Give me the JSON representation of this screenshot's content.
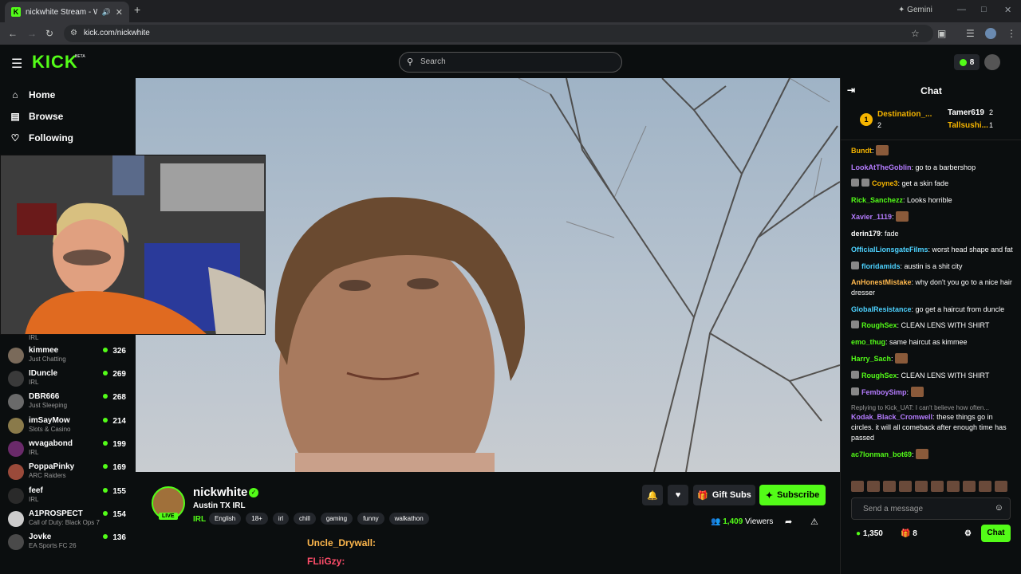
{
  "browser": {
    "tab_title": "nickwhite Stream - Watch L...",
    "favicon_text": "K",
    "new_tab": "+",
    "gemini_label": "Gemini",
    "url": "kick.com/nickwhite"
  },
  "header": {
    "logo": "KICK",
    "beta": "BETA",
    "search_placeholder": "Search",
    "points": "8"
  },
  "sidebar": {
    "nav": [
      {
        "label": "Home",
        "icon": "home-icon"
      },
      {
        "label": "Browse",
        "icon": "browse-icon"
      },
      {
        "label": "Following",
        "icon": "heart-icon"
      }
    ],
    "partial_category": "IRL",
    "channels": [
      {
        "name": "kimmee",
        "category": "Just Chatting",
        "viewers": "326"
      },
      {
        "name": "IDuncle",
        "category": "IRL",
        "viewers": "269"
      },
      {
        "name": "DBR666",
        "category": "Just Sleeping",
        "viewers": "268"
      },
      {
        "name": "imSayMow",
        "category": "Slots & Casino",
        "viewers": "214"
      },
      {
        "name": "wvagabond",
        "category": "IRL",
        "viewers": "199"
      },
      {
        "name": "PoppaPinky",
        "category": "ARC Raiders",
        "viewers": "169"
      },
      {
        "name": "feef",
        "category": "IRL",
        "viewers": "155"
      },
      {
        "name": "A1PROSPECT",
        "category": "Call of Duty: Black Ops 7",
        "viewers": "154"
      },
      {
        "name": "Jovke",
        "category": "EA Sports FC 26",
        "viewers": "136"
      }
    ]
  },
  "stream": {
    "name": "nickwhite",
    "title": "Austin TX IRL",
    "category": "IRL",
    "tags": [
      "English",
      "18+",
      "irl",
      "chill",
      "gaming",
      "funny",
      "walkathon"
    ],
    "live_badge": "LIVE",
    "gift_subs": "Gift Subs",
    "subscribe": "Subscribe",
    "viewers": "1,409",
    "viewers_label": "Viewers"
  },
  "overlay": {
    "line1": "Uncle_Drywall:",
    "line2": "FLiiGzy:"
  },
  "chat": {
    "title": "Chat",
    "leaderboard": [
      {
        "rank": "1",
        "name": "Destination_...",
        "count": "2"
      },
      {
        "name": "Tamer619",
        "count": "2"
      },
      {
        "name": "Tallsushi...",
        "count": "1"
      }
    ],
    "messages": [
      {
        "user": "Bundt",
        "color": "#f5b400",
        "text": "",
        "emote": true
      },
      {
        "user": "LookAtTheGoblin",
        "color": "#b57cff",
        "text": "go to a barbershop"
      },
      {
        "user": "Coyne3",
        "color": "#f5b400",
        "text": "get a skin fade",
        "badges": 2
      },
      {
        "user": "Rick_Sanchezz",
        "color": "#53fc18",
        "text": "Looks horrible"
      },
      {
        "user": "Xavier_1119",
        "color": "#b57cff",
        "text": "",
        "emote": true
      },
      {
        "user": "derin179",
        "color": "#fff",
        "text": "fade"
      },
      {
        "user": "OfficialLionsgateFilms",
        "color": "#4dd2ff",
        "text": "worst head shape and fat"
      },
      {
        "user": "floridamids",
        "color": "#4dd2ff",
        "text": "austin is a shit city",
        "badges": 1
      },
      {
        "user": "AnHonestMistake",
        "color": "#ffb84d",
        "text": "why don't you go to a nice hair dresser"
      },
      {
        "user": "GlobalResistance",
        "color": "#4dd2ff",
        "text": "go get a haircut from duncle"
      },
      {
        "user": "RoughSex",
        "color": "#53fc18",
        "text": "CLEAN LENS WITH SHIRT",
        "badges": 1
      },
      {
        "user": "emo_thug",
        "color": "#53fc18",
        "text": "same haircut as kimmee"
      },
      {
        "user": "Harry_Sach",
        "color": "#53fc18",
        "text": "",
        "emote": true
      },
      {
        "user": "RoughSex",
        "color": "#53fc18",
        "text": "CLEAN LENS WITH SHIRT",
        "badges": 1
      },
      {
        "user": "FemboySimp",
        "color": "#b57cff",
        "text": "",
        "emote": true,
        "badges": 1
      },
      {
        "reply": "Replying to Kick_UAT: I can't believe how often...",
        "user": "Kodak_Black_Cromwell",
        "color": "#b57cff",
        "text": "these things go in circles. it will all comeback after enough time has passed"
      },
      {
        "user": "ac7lonman_bot69",
        "color": "#53fc18",
        "text": "",
        "emote": true
      }
    ],
    "input_placeholder": "Send a message",
    "points_total": "1,350",
    "gift_count": "8",
    "send_label": "Chat"
  }
}
